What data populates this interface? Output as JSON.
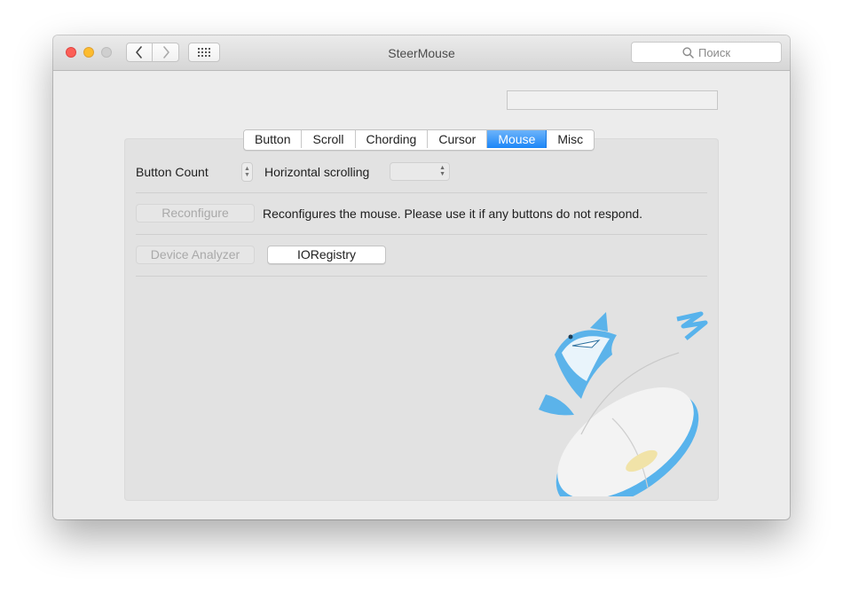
{
  "window": {
    "title": "SteerMouse"
  },
  "toolbar": {
    "search_placeholder": "Поиск",
    "back_icon": "chevron-left-icon",
    "forward_icon": "chevron-right-icon",
    "show_all_icon": "grid-icon",
    "search_icon": "magnifier-icon"
  },
  "tabs": [
    {
      "label": "Button",
      "active": false
    },
    {
      "label": "Scroll",
      "active": false
    },
    {
      "label": "Chording",
      "active": false
    },
    {
      "label": "Cursor",
      "active": false
    },
    {
      "label": "Mouse",
      "active": true
    },
    {
      "label": "Misc",
      "active": false
    }
  ],
  "mouse_tab": {
    "button_count_label": "Button Count",
    "horizontal_scrolling_label": "Horizontal scrolling",
    "reconfigure_button": "Reconfigure",
    "reconfigure_desc": "Reconfigures the mouse. Please use it if any buttons do not respond.",
    "device_analyzer_button": "Device Analyzer",
    "ioregistry_button": "IORegistry"
  },
  "colors": {
    "accent": "#1c86f7",
    "close": "#fc5f57",
    "minimize": "#fdbc2e",
    "zoom_inactive": "#cfcfcf",
    "mascot_blue": "#4fb0ef"
  },
  "illustration": {
    "icon": "steermouse-shark-on-mouse-logo"
  }
}
